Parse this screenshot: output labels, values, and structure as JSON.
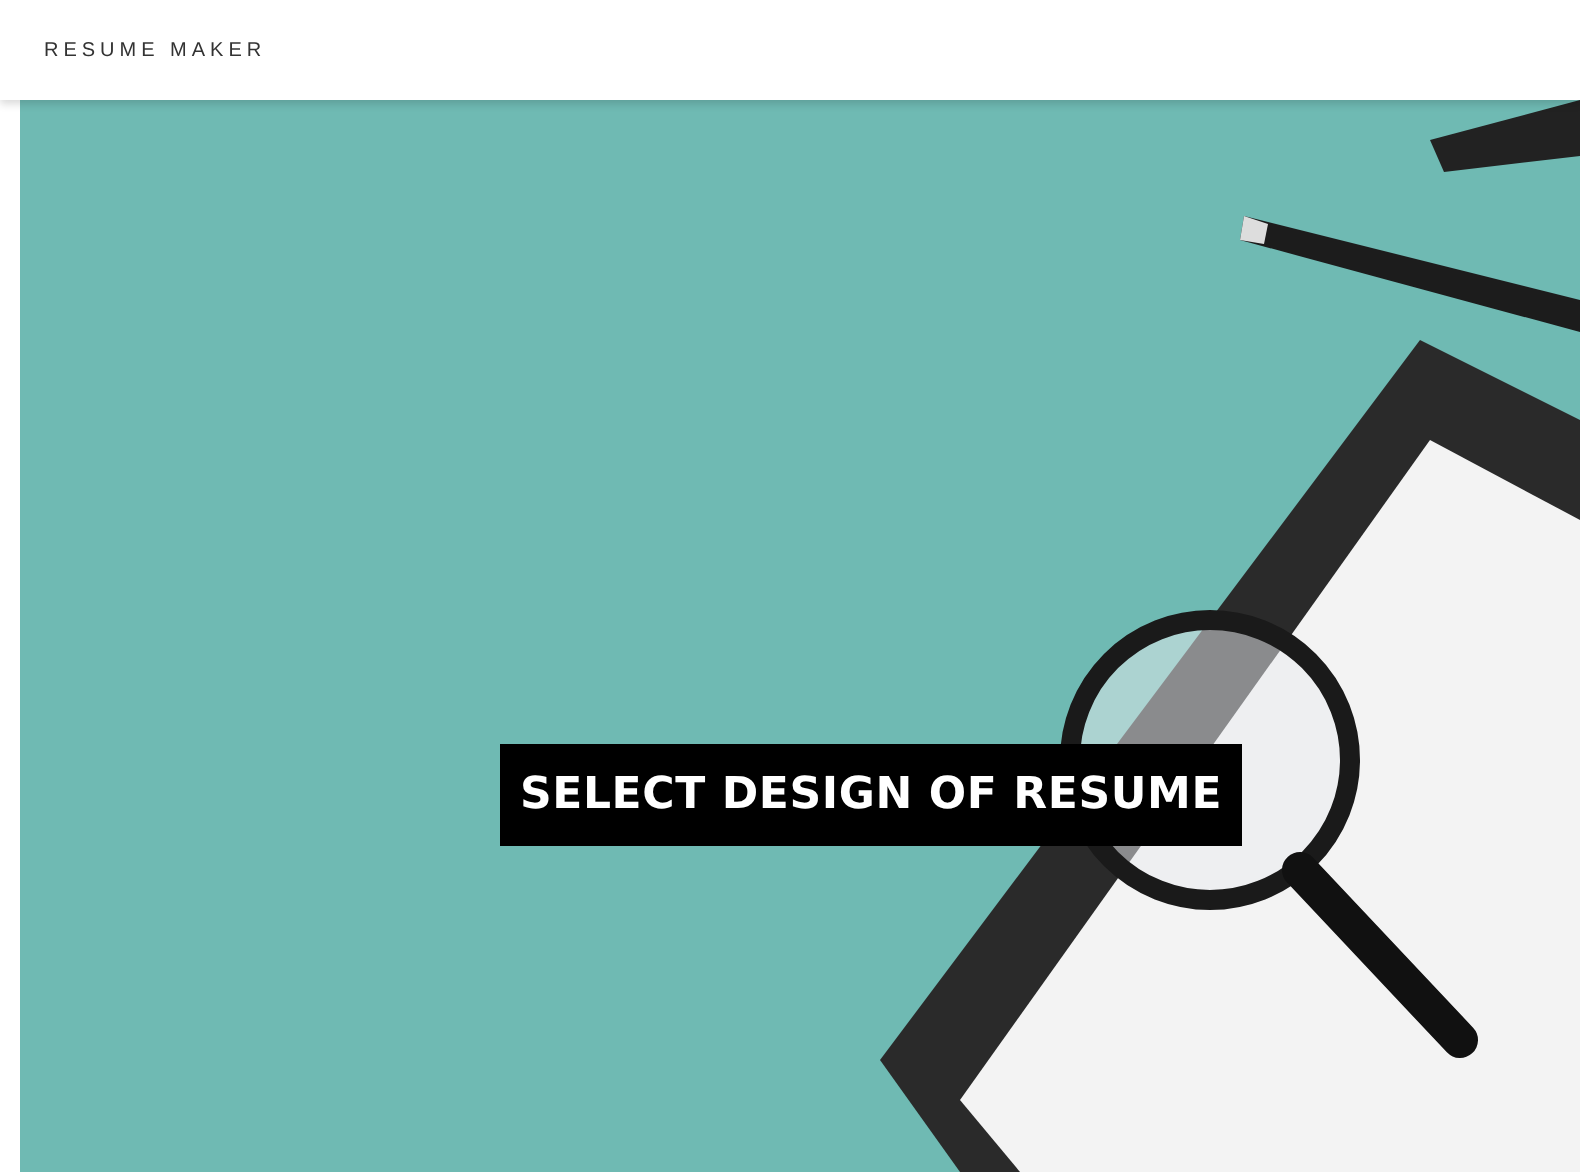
{
  "navbar": {
    "brand": "RESUME MAKER"
  },
  "hero": {
    "title": "SELECT DESIGN OF RESUME"
  }
}
